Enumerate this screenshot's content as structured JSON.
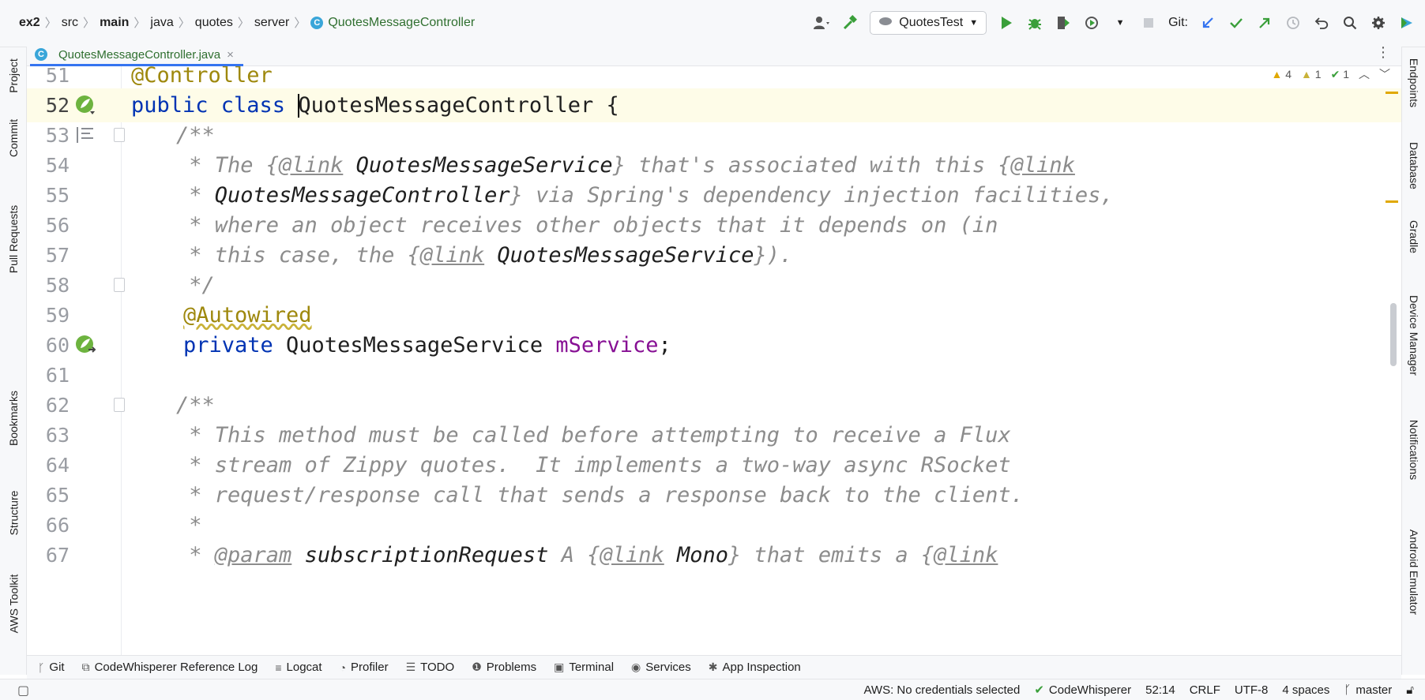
{
  "breadcrumbs": {
    "items": [
      "ex2",
      "src",
      "main",
      "java",
      "quotes",
      "server",
      "QuotesMessageController"
    ],
    "class_badge": "C"
  },
  "toolbar": {
    "run_config": "QuotesTest",
    "git_label": "Git:"
  },
  "left_tabs": [
    "Project",
    "Commit",
    "Pull Requests",
    "Bookmarks",
    "Structure",
    "AWS Toolkit"
  ],
  "right_tabs": [
    "Endpoints",
    "Database",
    "Gradle",
    "Device Manager",
    "Notifications",
    "Android Emulator"
  ],
  "editor_tab": {
    "filename": "QuotesMessageController.java",
    "badge": "C",
    "close": "×"
  },
  "inspections": {
    "warnings": "4",
    "weak_warnings": "1",
    "typos": "1"
  },
  "code_lines": [
    {
      "n": "51"
    },
    {
      "n": "52"
    },
    {
      "n": "53"
    },
    {
      "n": "54"
    },
    {
      "n": "55"
    },
    {
      "n": "56"
    },
    {
      "n": "57"
    },
    {
      "n": "58"
    },
    {
      "n": "59"
    },
    {
      "n": "60"
    },
    {
      "n": "61"
    },
    {
      "n": "62"
    },
    {
      "n": "63"
    },
    {
      "n": "64"
    },
    {
      "n": "65"
    },
    {
      "n": "66"
    },
    {
      "n": "67"
    }
  ],
  "code": {
    "l51_ann": "@Controller",
    "l52_kw": "public class ",
    "l52_name": "QuotesMessageController {",
    "l53": "/**",
    "l54_a": " * The {",
    "l54_tag": "@link",
    "l54_ref": " QuotesMessageService",
    "l54_b": "} that's associated with this {",
    "l54_tag2": "@link",
    "l55_a": " * ",
    "l55_ref": "QuotesMessageController",
    "l55_b": "} via Spring's dependency injection facilities,",
    "l56": " * where an object receives other objects that it depends on (in",
    "l57_a": " * this case, the {",
    "l57_tag": "@link",
    "l57_ref": " QuotesMessageService",
    "l57_b": "}).",
    "l58": " */",
    "l59_ann": "@Autowired",
    "l60_kw": "private ",
    "l60_type": "QuotesMessageService ",
    "l60_field": "mService",
    "l60_end": ";",
    "l62": "/**",
    "l63": " * This method must be called before attempting to receive a Flux",
    "l64": " * stream of Zippy quotes.  It implements a two-way async RSocket",
    "l65": " * request/response call that sends a response back to the client.",
    "l66": " *",
    "l67_a": " * ",
    "l67_tag": "@param",
    "l67_ref": " subscriptionRequest",
    "l67_b": " A {",
    "l67_tag2": "@link",
    "l67_ref2": " Mono",
    "l67_c": "} that emits a {",
    "l67_tag3": "@link"
  },
  "bottom_tools": [
    "Git",
    "CodeWhisperer Reference Log",
    "Logcat",
    "Profiler",
    "TODO",
    "Problems",
    "Terminal",
    "Services",
    "App Inspection"
  ],
  "status": {
    "aws": "AWS: No credentials selected",
    "codewhisperer": "CodeWhisperer",
    "position": "52:14",
    "line_sep": "CRLF",
    "encoding": "UTF-8",
    "indent": "4 spaces",
    "branch": "master"
  },
  "colors": {
    "keyword": "#0033b3",
    "annotation": "#9e880d",
    "comment": "#8c8c8c",
    "field": "#871094",
    "current_line": "#fefce8"
  }
}
